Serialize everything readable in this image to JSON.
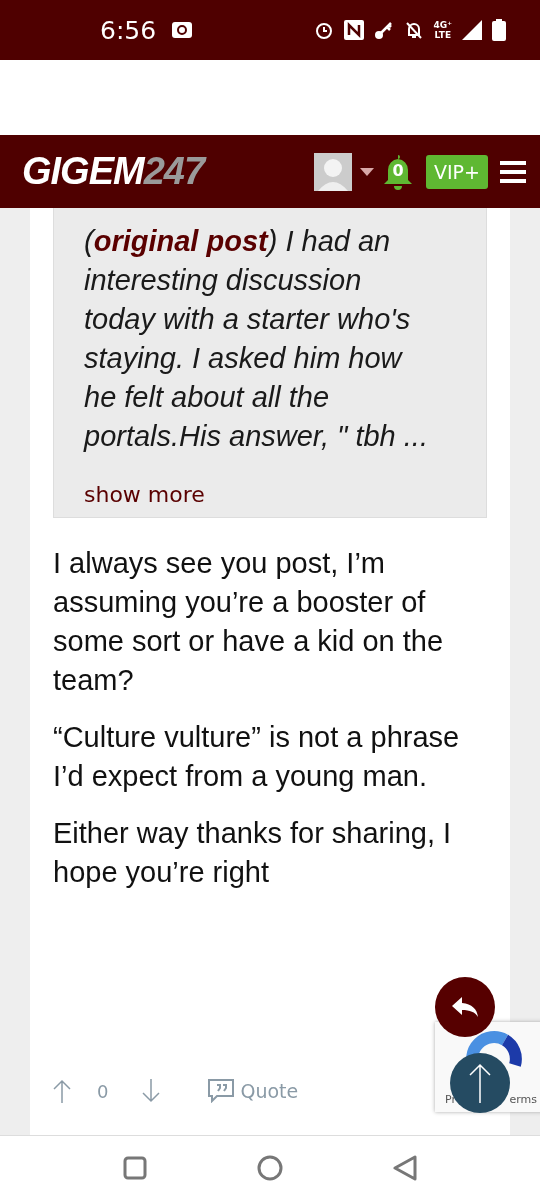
{
  "status_bar": {
    "time": "6:56",
    "network": "4G⁺\nLTE"
  },
  "header": {
    "logo_main": "GIGEM",
    "logo_num": "247",
    "notifications": "0",
    "vip": "VIP+"
  },
  "quote": {
    "text": "(**original post**) I had an interesting discussion today with a starter who's staying. I asked him how he felt about all the portals.His answer, \" tbh ...",
    "more": "show more"
  },
  "paragraphs": [
    "I always see you post, I’m assuming you’re a booster of some sort or have a kid on the team?",
    "“Culture vulture” is not a phrase I’d expect from a young man.",
    "Either way thanks for sharing, I hope you’re right"
  ],
  "actions": {
    "score": "0",
    "quote": "Quote"
  },
  "recaptcha": {
    "left": "Pr",
    "right": "erms"
  }
}
